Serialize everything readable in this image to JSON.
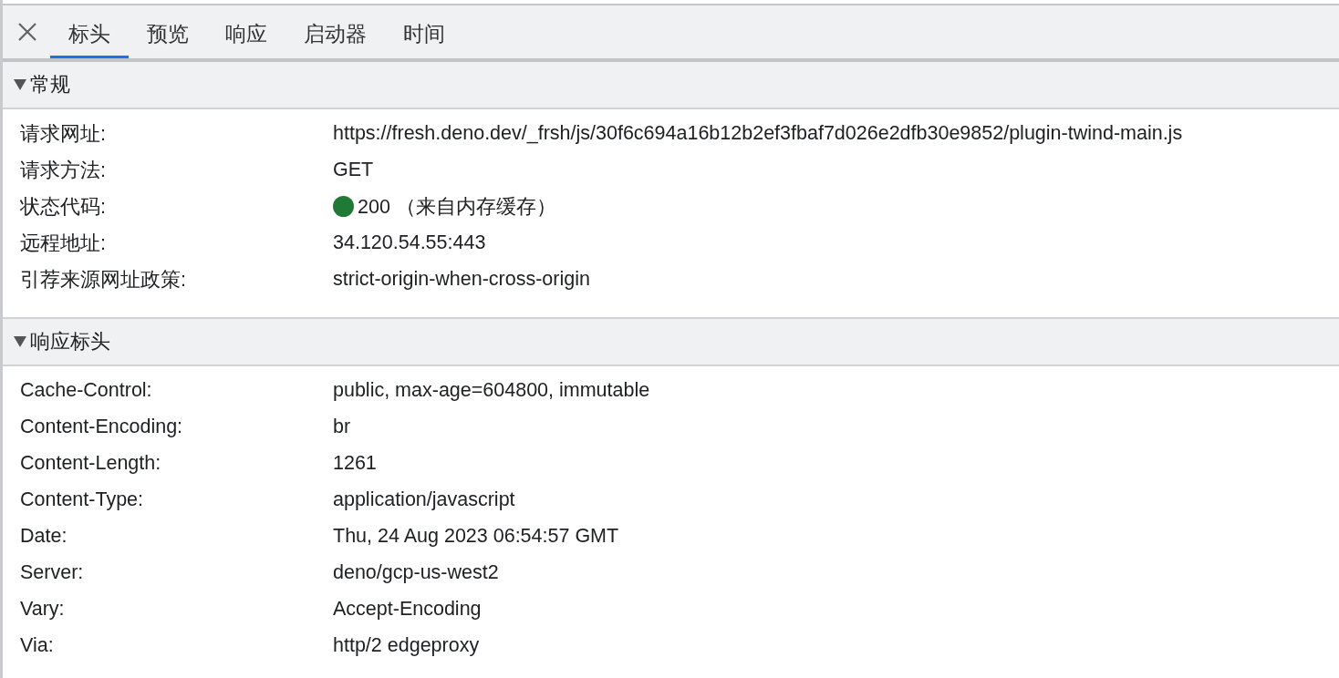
{
  "tabs": [
    {
      "label": "标头",
      "selected": true
    },
    {
      "label": "预览",
      "selected": false
    },
    {
      "label": "响应",
      "selected": false
    },
    {
      "label": "启动器",
      "selected": false
    },
    {
      "label": "时间",
      "selected": false
    }
  ],
  "sections": [
    {
      "title": "常规",
      "expanded": true,
      "rows": [
        {
          "name": "请求网址:",
          "value": "https://fresh.deno.dev/_frsh/js/30f6c694a16b12b2ef3fbaf7d026e2dfb30e9852/plugin-twind-main.js"
        },
        {
          "name": "请求方法:",
          "value": "GET"
        },
        {
          "name": "状态代码:",
          "value": "200 （来自内存缓存）",
          "color": "#1e7a34"
        },
        {
          "name": "远程地址:",
          "value": "34.120.54.55:443"
        },
        {
          "name": "引荐来源网址政策:",
          "value": "strict-origin-when-cross-origin"
        }
      ]
    },
    {
      "title": "响应标头",
      "expanded": true,
      "rows": [
        {
          "name": "Cache-Control:",
          "value": "public, max-age=604800, immutable"
        },
        {
          "name": "Content-Encoding:",
          "value": "br"
        },
        {
          "name": "Content-Length:",
          "value": "1261"
        },
        {
          "name": "Content-Type:",
          "value": "application/javascript"
        },
        {
          "name": "Date:",
          "value": "Thu, 24 Aug 2023 06:54:57 GMT"
        },
        {
          "name": "Server:",
          "value": "deno/gcp-us-west2"
        },
        {
          "name": "Vary:",
          "value": "Accept-Encoding"
        },
        {
          "name": "Via:",
          "value": "http/2 edgeproxy"
        }
      ]
    }
  ]
}
